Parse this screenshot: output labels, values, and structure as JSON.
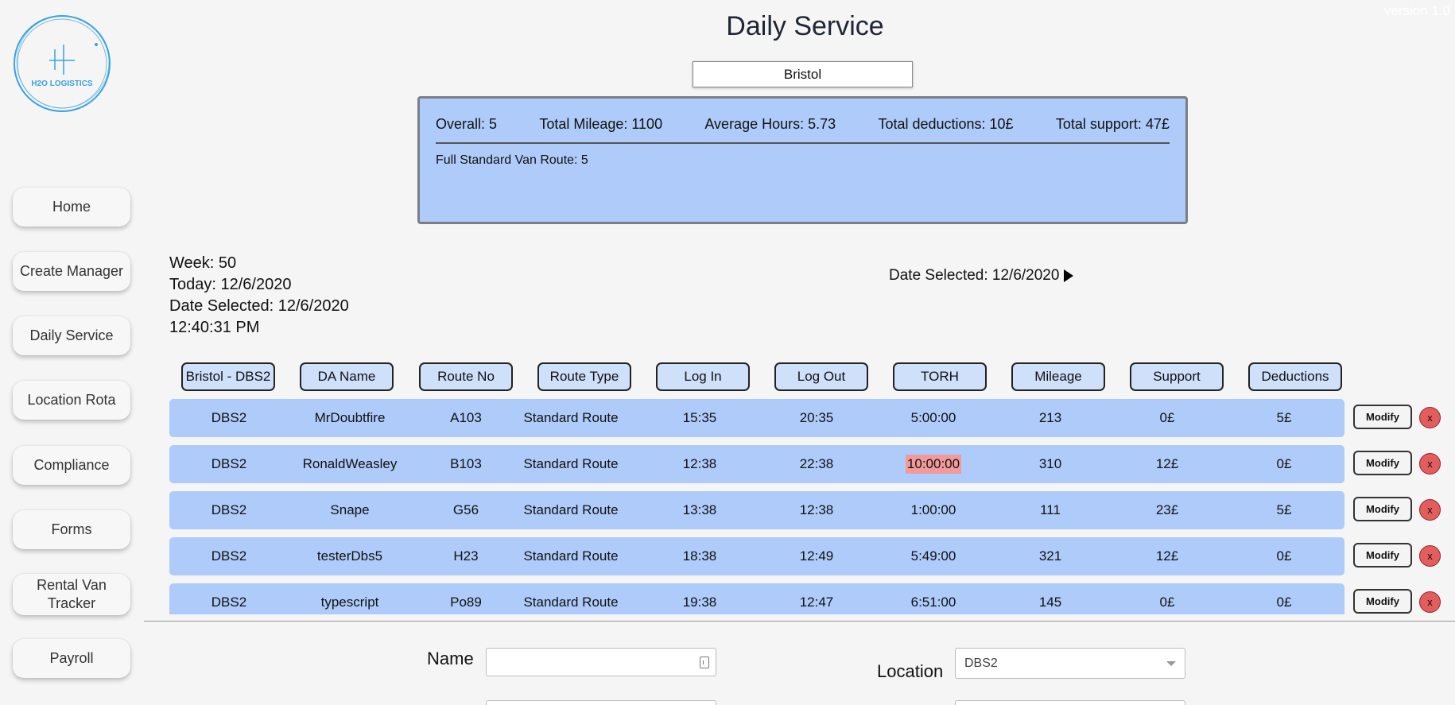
{
  "app": {
    "version": "version 1.0",
    "logo_text": "H2O LOGISTICS"
  },
  "sidebar": {
    "items": [
      {
        "label": "Home"
      },
      {
        "label": "Create Manager"
      },
      {
        "label": "Daily Service"
      },
      {
        "label": "Location Rota"
      },
      {
        "label": "Compliance"
      },
      {
        "label": "Forms"
      },
      {
        "label": "Rental Van Tracker"
      },
      {
        "label": "Payroll"
      }
    ]
  },
  "page": {
    "title": "Daily Service",
    "location": "Bristol"
  },
  "summary": {
    "overall": "Overall: 5",
    "mileage": "Total Mileage: 1100",
    "hours": "Average Hours: 5.73",
    "deductions": "Total deductions: 10£",
    "support": "Total support: 47£",
    "route_summary": "Full Standard Van Route: 5"
  },
  "info": {
    "week": "Week: 50",
    "today": "Today: 12/6/2020",
    "date_selected": "Date Selected: 12/6/2020",
    "time": "12:40:31 PM"
  },
  "date_nav": {
    "label": "Date Selected: 12/6/2020"
  },
  "table": {
    "headers": [
      "Bristol - DBS2",
      "DA Name",
      "Route No",
      "Route Type",
      "Log In",
      "Log Out",
      "TORH",
      "Mileage",
      "Support",
      "Deductions"
    ],
    "rows": [
      [
        "DBS2",
        "MrDoubtfire",
        "A103",
        "Standard Route",
        "15:35",
        "20:35",
        "5:00:00",
        "213",
        "0£",
        "5£"
      ],
      [
        "DBS2",
        "RonaldWeasley",
        "B103",
        "Standard Route",
        "12:38",
        "22:38",
        "10:00:00",
        "310",
        "12£",
        "0£"
      ],
      [
        "DBS2",
        "Snape",
        "G56",
        "Standard Route",
        "13:38",
        "12:38",
        "1:00:00",
        "111",
        "23£",
        "5£"
      ],
      [
        "DBS2",
        "testerDbs5",
        "H23",
        "Standard Route",
        "18:38",
        "12:49",
        "5:49:00",
        "321",
        "12£",
        "0£"
      ],
      [
        "DBS2",
        "typescript",
        "Po89",
        "Standard Route",
        "19:38",
        "12:47",
        "6:51:00",
        "145",
        "0£",
        "0£"
      ]
    ],
    "modify_label": "Modify",
    "delete_label": "x"
  },
  "form": {
    "name_label": "Name",
    "name_value": "",
    "location_label": "Location",
    "location_value": "DBS2"
  },
  "colors": {
    "row_bg": "#aecbfa",
    "highlight": "#f29a9a",
    "delete": "#e35d5d"
  }
}
